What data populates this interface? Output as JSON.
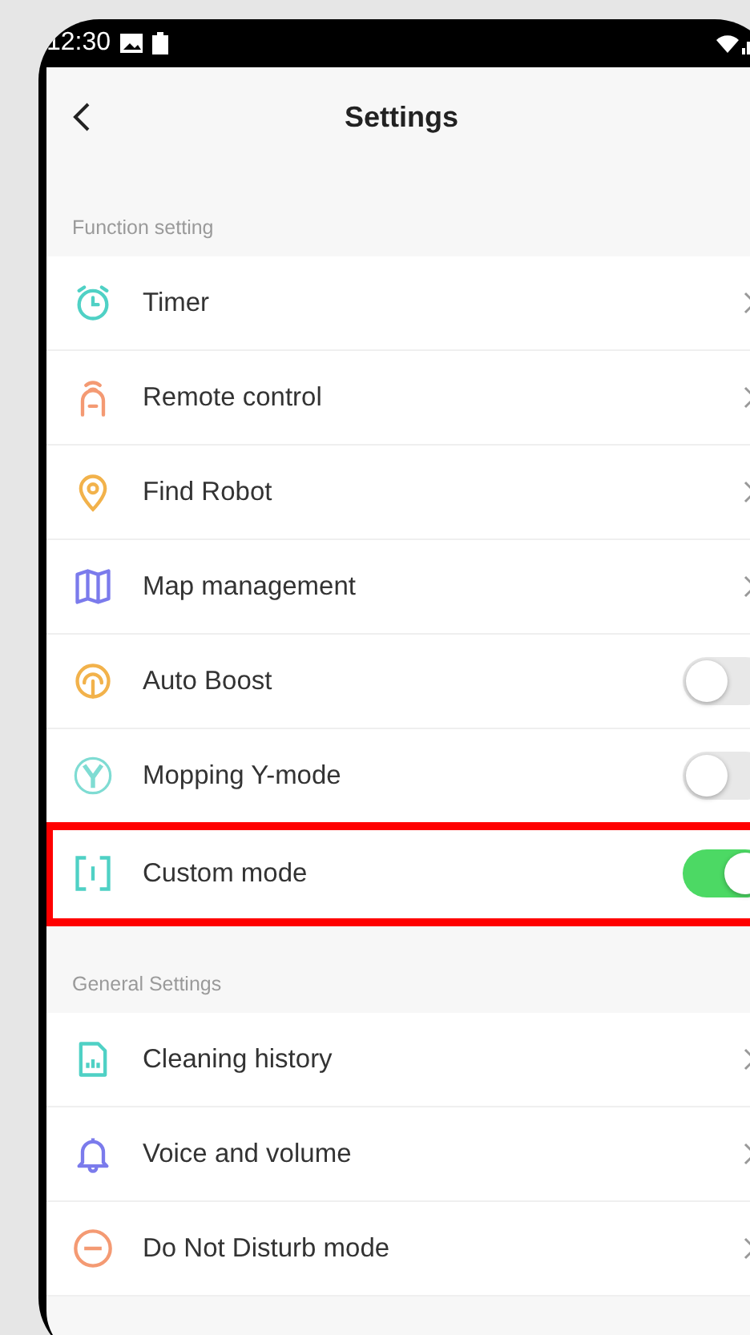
{
  "status_bar": {
    "time": "12:30"
  },
  "header": {
    "title": "Settings"
  },
  "sections": [
    {
      "title": "Function setting",
      "items": [
        {
          "kind": "link",
          "label": "Timer",
          "highlighted": false
        },
        {
          "kind": "link",
          "label": "Remote control",
          "highlighted": false
        },
        {
          "kind": "link",
          "label": "Find Robot",
          "highlighted": false
        },
        {
          "kind": "link",
          "label": "Map management",
          "highlighted": false
        },
        {
          "kind": "toggle",
          "label": "Auto Boost",
          "on": false,
          "highlighted": false
        },
        {
          "kind": "toggle",
          "label": "Mopping Y-mode",
          "on": false,
          "highlighted": false
        },
        {
          "kind": "toggle",
          "label": "Custom mode",
          "on": true,
          "highlighted": true
        }
      ]
    },
    {
      "title": "General Settings",
      "items": [
        {
          "kind": "link",
          "label": "Cleaning history",
          "highlighted": false
        },
        {
          "kind": "link",
          "label": "Voice and volume",
          "highlighted": false
        },
        {
          "kind": "link",
          "label": "Do Not Disturb mode",
          "highlighted": false
        }
      ]
    }
  ]
}
